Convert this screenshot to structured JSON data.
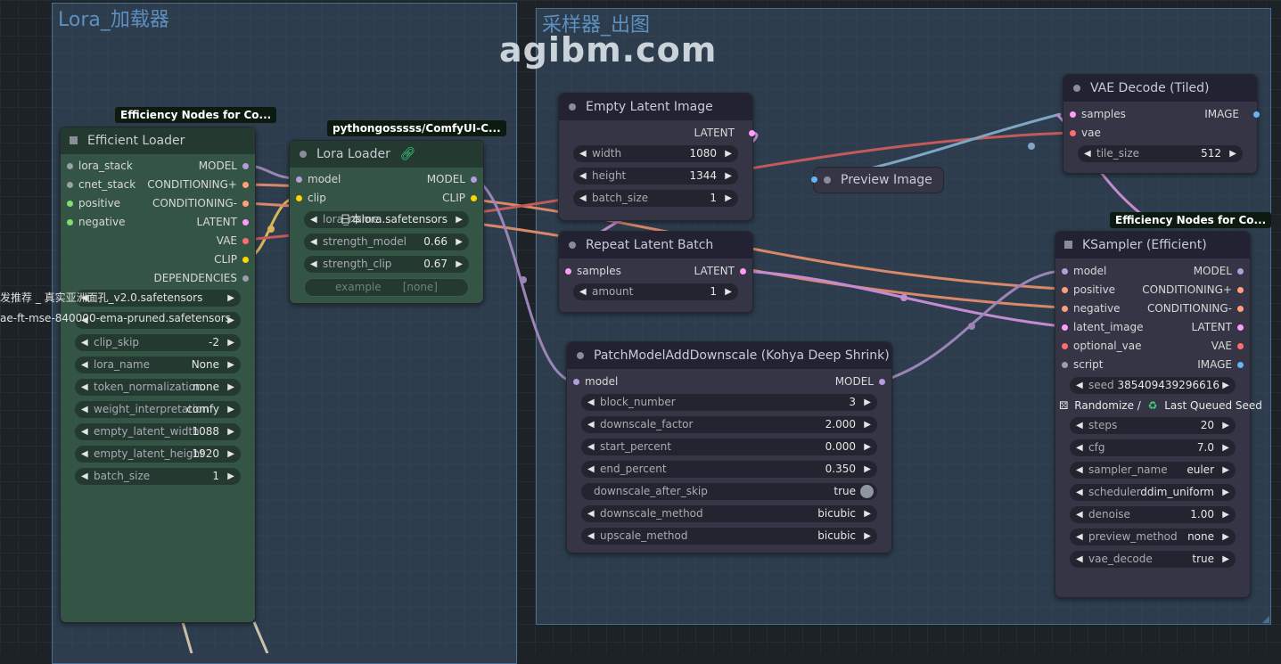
{
  "watermark": "agibm.com",
  "groups": {
    "lora": "Lora_加载器",
    "sampler": "采样器_出图"
  },
  "colors": {
    "model": "#b39ddb",
    "conditioning": "#ffa07a",
    "latent": "#ff9cf9",
    "vae": "#ff6e6e",
    "clip": "#ffd500",
    "image": "#64b5f6",
    "wire_model": "#9b84b6",
    "wire_cond": "#d9886a",
    "wire_vae": "#c35a5a",
    "wire_clip": "#d8b45a",
    "wire_image": "#7fa6c4"
  },
  "efficient_loader": {
    "badge": "Efficiency Nodes for Co...",
    "title": "Efficient Loader",
    "inputs": [
      "lora_stack",
      "cnet_stack",
      "positive",
      "negative"
    ],
    "outputs": [
      "MODEL",
      "CONDITIONING+",
      "CONDITIONING-",
      "LATENT",
      "VAE",
      "CLIP",
      "DEPENDENCIES"
    ],
    "cut_text_1": "发推荐 _ 真实亚洲面孔_v2.0.safetensors",
    "cut_text_2": "ae-ft-mse-840000-ema-pruned.safetensors",
    "widgets": [
      {
        "label": "clip_skip",
        "value": "-2"
      },
      {
        "label": "lora_name",
        "value": "None"
      },
      {
        "label": "token_normalization",
        "value": "none"
      },
      {
        "label": "weight_interpretation",
        "value": "comfy"
      },
      {
        "label": "empty_latent_width",
        "value": "1088"
      },
      {
        "label": "empty_latent_height",
        "value": "1920"
      },
      {
        "label": "batch_size",
        "value": "1"
      }
    ]
  },
  "lora_loader": {
    "badge": "pythongosssss/ComfyUI-C...",
    "title": "Lora Loader",
    "link_icon": "link-icon",
    "inputs": [
      "model",
      "clip"
    ],
    "outputs": [
      "MODEL",
      "CLIP"
    ],
    "widgets": [
      {
        "label": "lora_name",
        "value": "日本lora.safetensors"
      },
      {
        "label": "strength_model",
        "value": "0.66"
      },
      {
        "label": "strength_clip",
        "value": "0.67"
      }
    ],
    "disabled_widget": {
      "label": "example",
      "value": "[none]"
    }
  },
  "empty_latent": {
    "title": "Empty Latent Image",
    "output": "LATENT",
    "widgets": [
      {
        "label": "width",
        "value": "1080"
      },
      {
        "label": "height",
        "value": "1344"
      },
      {
        "label": "batch_size",
        "value": "1"
      }
    ]
  },
  "repeat_latent": {
    "title": "Repeat Latent Batch",
    "input": "samples",
    "output": "LATENT",
    "widgets": [
      {
        "label": "amount",
        "value": "1"
      }
    ]
  },
  "preview_image": {
    "title": "Preview Image"
  },
  "vae_decode": {
    "title": "VAE Decode (Tiled)",
    "inputs": [
      "samples",
      "vae"
    ],
    "output": "IMAGE",
    "widgets": [
      {
        "label": "tile_size",
        "value": "512"
      }
    ]
  },
  "patch_model": {
    "title": "PatchModelAddDownscale (Kohya Deep Shrink)",
    "input": "model",
    "output": "MODEL",
    "widgets": [
      {
        "label": "block_number",
        "value": "3"
      },
      {
        "label": "downscale_factor",
        "value": "2.000"
      },
      {
        "label": "start_percent",
        "value": "0.000"
      },
      {
        "label": "end_percent",
        "value": "0.350"
      }
    ],
    "toggle": {
      "label": "downscale_after_skip",
      "value": "true"
    },
    "widgets2": [
      {
        "label": "downscale_method",
        "value": "bicubic"
      },
      {
        "label": "upscale_method",
        "value": "bicubic"
      }
    ]
  },
  "ksampler": {
    "badge": "Efficiency Nodes for Co...",
    "title": "KSampler (Efficient)",
    "inputs": [
      "model",
      "positive",
      "negative",
      "latent_image",
      "optional_vae",
      "script"
    ],
    "outputs": [
      "MODEL",
      "CONDITIONING+",
      "CONDITIONING-",
      "LATENT",
      "VAE",
      "IMAGE"
    ],
    "seed": {
      "label": "seed",
      "value": "385409439296616"
    },
    "randomize_text": "Randomize /",
    "recycle_icon": "recycle-icon",
    "last_queued": "Last Queued Seed",
    "dice_icon": "dice-icon",
    "widgets": [
      {
        "label": "steps",
        "value": "20"
      },
      {
        "label": "cfg",
        "value": "7.0"
      },
      {
        "label": "sampler_name",
        "value": "euler"
      },
      {
        "label": "scheduler",
        "value": "ddim_uniform"
      },
      {
        "label": "denoise",
        "value": "1.00"
      },
      {
        "label": "preview_method",
        "value": "none"
      },
      {
        "label": "vae_decode",
        "value": "true"
      }
    ]
  }
}
